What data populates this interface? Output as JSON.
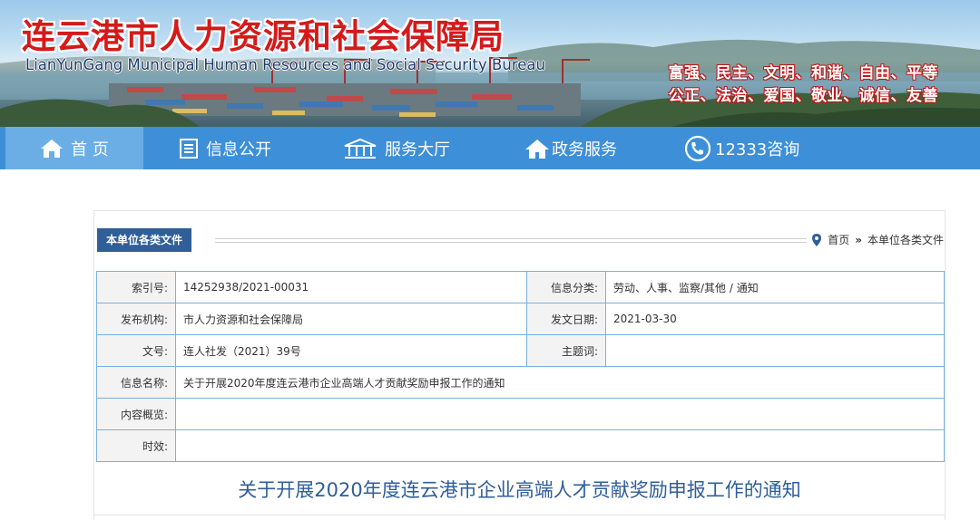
{
  "header": {
    "title_cn": "连云港市人力资源和社会保障局",
    "title_en": "LianYunGang Municipal Human Resources and Social Security Bureau",
    "slogan_line1": "富强、民主、文明、和谐、自由、平等",
    "slogan_line2": "公正、法治、爱国、敬业、诚信、友善"
  },
  "nav": {
    "items": [
      {
        "label": "首 页",
        "icon": "home-icon"
      },
      {
        "label": "信息公开",
        "icon": "document-list-icon"
      },
      {
        "label": "服务大厅",
        "icon": "building-icon"
      },
      {
        "label": "政务服务",
        "icon": "house-icon"
      },
      {
        "label": "12333咨询",
        "icon": "phone-icon"
      }
    ]
  },
  "section": {
    "title": "本单位各类文件",
    "breadcrumb": {
      "home": "首页",
      "separator": "»",
      "current": "本单位各类文件"
    }
  },
  "info_table": {
    "index_label": "索引号:",
    "index_value": "14252938/2021-00031",
    "category_label": "信息分类:",
    "category_value": "劳动、人事、监察/其他 / 通知",
    "publisher_label": "发布机构:",
    "publisher_value": "市人力资源和社会保障局",
    "date_label": "发文日期:",
    "date_value": "2021-03-30",
    "docno_label": "文号:",
    "docno_value": "连人社发（2021）39号",
    "keywords_label": "主题词:",
    "keywords_value": "",
    "name_label": "信息名称:",
    "name_value": "关于开展2020年度连云港市企业高端人才贡献奖励申报工作的通知",
    "summary_label": "内容概览:",
    "summary_value": "",
    "validity_label": "时效:",
    "validity_value": ""
  },
  "document": {
    "title": "关于开展2020年度连云港市企业高端人才贡献奖励申报工作的通知"
  },
  "colors": {
    "nav_bg": "#3d8fd8",
    "nav_active": "#6baee6",
    "accent_blue": "#2f5e98",
    "title_red": "#d41a1a",
    "table_border": "#7ab0dc"
  }
}
